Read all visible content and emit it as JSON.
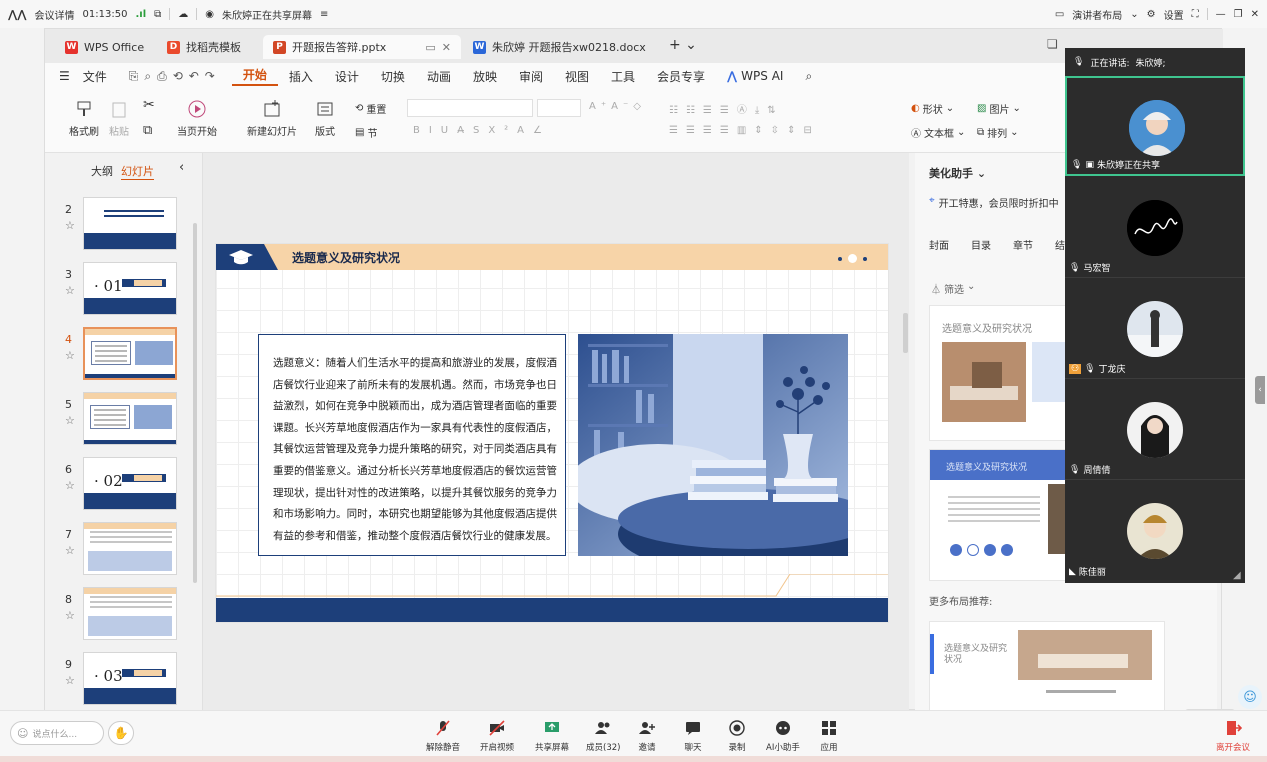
{
  "meeting_top": {
    "details": "会议详情",
    "time": "01:13:50",
    "sharing": "朱欣婷正在共享屏幕",
    "presenter_layout": "演讲者布局",
    "settings": "设置"
  },
  "tabs": [
    {
      "label": "WPS Office"
    },
    {
      "label": "找稻壳模板"
    },
    {
      "label": "开题报告答辩.pptx"
    },
    {
      "label": "朱欣婷 开题报告xw0218.docx"
    }
  ],
  "menu": {
    "file": "文件",
    "items": [
      "开始",
      "插入",
      "设计",
      "切换",
      "动画",
      "放映",
      "审阅",
      "视图",
      "工具",
      "会员专享"
    ],
    "ai": "WPS AI"
  },
  "ribbon": {
    "format_painter": "格式刷",
    "paste": "粘贴",
    "from_start": "当页开始",
    "new_slide": "新建幻灯片",
    "layout": "版式",
    "section": "节",
    "reset": "重置",
    "shape": "形状",
    "picture": "图片",
    "textbox": "文本框",
    "arrange": "排列"
  },
  "left_panel": {
    "outline": "大纲",
    "slides": "幻灯片"
  },
  "slides": [
    {
      "num": "2",
      "type": "toc"
    },
    {
      "num": "3",
      "type": "section",
      "section": "01"
    },
    {
      "num": "4",
      "type": "content",
      "selected": true
    },
    {
      "num": "5",
      "type": "content"
    },
    {
      "num": "6",
      "type": "section",
      "section": "02"
    },
    {
      "num": "7",
      "type": "building"
    },
    {
      "num": "8",
      "type": "building"
    },
    {
      "num": "9",
      "type": "section",
      "section": "03"
    }
  ],
  "slide": {
    "title": "选题意义及研究状况",
    "body": "选题意义：随着人们生活水平的提高和旅游业的发展，度假酒店餐饮行业迎来了前所未有的发展机遇。然而，市场竞争也日益激烈，如何在竞争中脱颖而出，成为酒店管理者面临的重要课题。长兴芳草地度假酒店作为一家具有代表性的度假酒店，其餐饮运营管理及竞争力提升策略的研究，对于同类酒店具有重要的借鉴意义。通过分析长兴芳草地度假酒店的餐饮运营管理现状，提出针对性的改进策略，以提升其餐饮服务的竞争力和市场影响力。同时，本研究也期望能够为其他度假酒店提供有益的参考和借鉴，推动整个度假酒店餐饮行业的健康发展。"
  },
  "right_panel": {
    "title": "美化助手",
    "promo": "开工特惠，会员限时折扣中",
    "cats": [
      "封面",
      "目录",
      "章节",
      "结"
    ],
    "filter": "筛选",
    "card1_label": "选题意义及研究状况",
    "card2_label": "选题意义及研究状况",
    "more": "更多布局推荐:",
    "card3_label": "选题意义及研究状况",
    "annotate": "批注"
  },
  "gallery": {
    "speaking_label": "正在讲话:",
    "speaking_name": "朱欣婷;",
    "participants": [
      {
        "name": "朱欣婷正在共享",
        "avatar": "woman-hat-icon"
      },
      {
        "name": "马宏智",
        "avatar": "signature-icon"
      },
      {
        "name": "丁龙庆",
        "avatar": "snow-man-icon"
      },
      {
        "name": "周倩倩",
        "avatar": "woman-dark-hair-icon"
      },
      {
        "name": "陈佳丽",
        "avatar": "young-man-icon"
      }
    ]
  },
  "bottom": {
    "chat_placeholder": "说点什么...",
    "buttons": [
      "解除静音",
      "开启视频",
      "共享屏幕",
      "成员(32)",
      "邀请",
      "聊天",
      "录制",
      "AI小助手",
      "应用"
    ],
    "leave": "离开会议"
  },
  "colors": {
    "accent": "#d3520f",
    "slide_blue": "#1d3f7a",
    "slide_peach": "#f7d4a8",
    "leave_red": "#e0413a"
  }
}
